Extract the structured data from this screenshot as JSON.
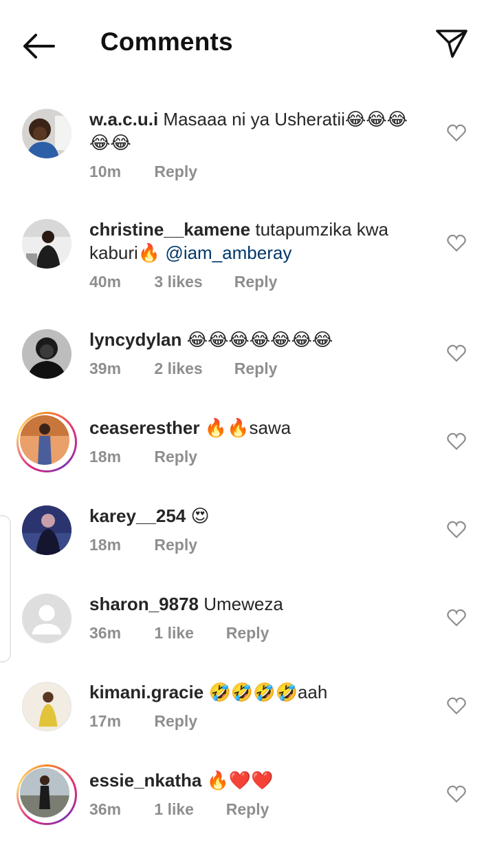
{
  "header": {
    "title": "Comments"
  },
  "comments": [
    {
      "user": "w.a.c.u.i",
      "text": "Masaaa ni ya Usheratii😂😂😂",
      "text2": "😂😂",
      "time": "10m",
      "likes": "",
      "reply": "Reply"
    },
    {
      "user": "christine__kamene",
      "text": "tutapumzika kwa",
      "text2": "kaburi🔥",
      "mention": "@iam_amberay",
      "time": "40m",
      "likes": "3 likes",
      "reply": "Reply"
    },
    {
      "user": "lyncydylan",
      "text": "😂😂😂😂😂😂😂",
      "time": "39m",
      "likes": "2 likes",
      "reply": "Reply"
    },
    {
      "user": "ceaseresther",
      "text": "🔥🔥sawa",
      "time": "18m",
      "likes": "",
      "reply": "Reply"
    },
    {
      "user": "karey__254",
      "text": "😍",
      "time": "18m",
      "likes": "",
      "reply": "Reply"
    },
    {
      "user": "sharon_9878",
      "text": "Umeweza",
      "time": "36m",
      "likes": "1 like",
      "reply": "Reply"
    },
    {
      "user": "kimani.gracie",
      "text": "🤣🤣🤣🤣aah",
      "time": "17m",
      "likes": "",
      "reply": "Reply"
    },
    {
      "user": "essie_nkatha",
      "text": "🔥❤️❤️",
      "time": "36m",
      "likes": "1 like",
      "reply": "Reply"
    }
  ],
  "icons": {
    "back": "arrow-left-icon",
    "send": "paper-plane-icon",
    "like": "heart-outline-icon"
  },
  "colors": {
    "text": "#262626",
    "secondary": "#8e8e8e",
    "mention": "#00376b",
    "story_ring_start": "#f58529",
    "story_ring_end": "#dd2a7b"
  }
}
